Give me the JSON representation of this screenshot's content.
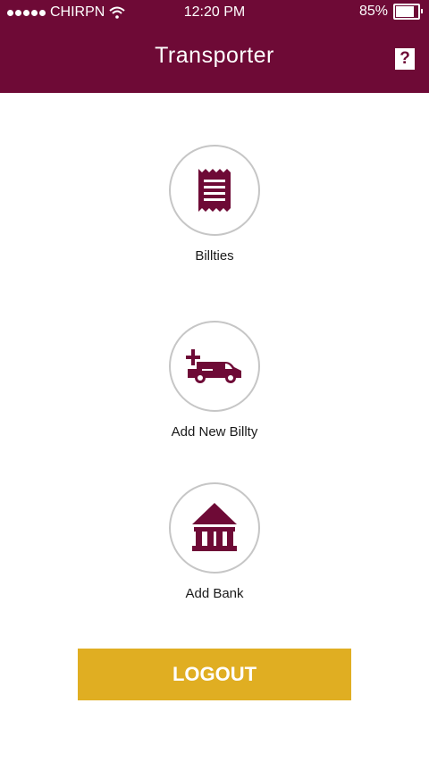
{
  "status_bar": {
    "carrier": "CHIRPN",
    "time": "12:20 PM",
    "battery": "85%",
    "battery_level": 0.85
  },
  "header": {
    "title": "Transporter",
    "help_label": "?"
  },
  "menu": {
    "items": [
      {
        "label": "Billties",
        "icon": "receipt-icon"
      },
      {
        "label": "Add New Billty",
        "icon": "add-truck-icon"
      },
      {
        "label": "Add Bank",
        "icon": "bank-icon"
      }
    ]
  },
  "logout": {
    "label": "LOGOUT"
  },
  "colors": {
    "brand": "#6e0a36",
    "accent": "#e0ae22",
    "circle_border": "#c6c6c6"
  }
}
